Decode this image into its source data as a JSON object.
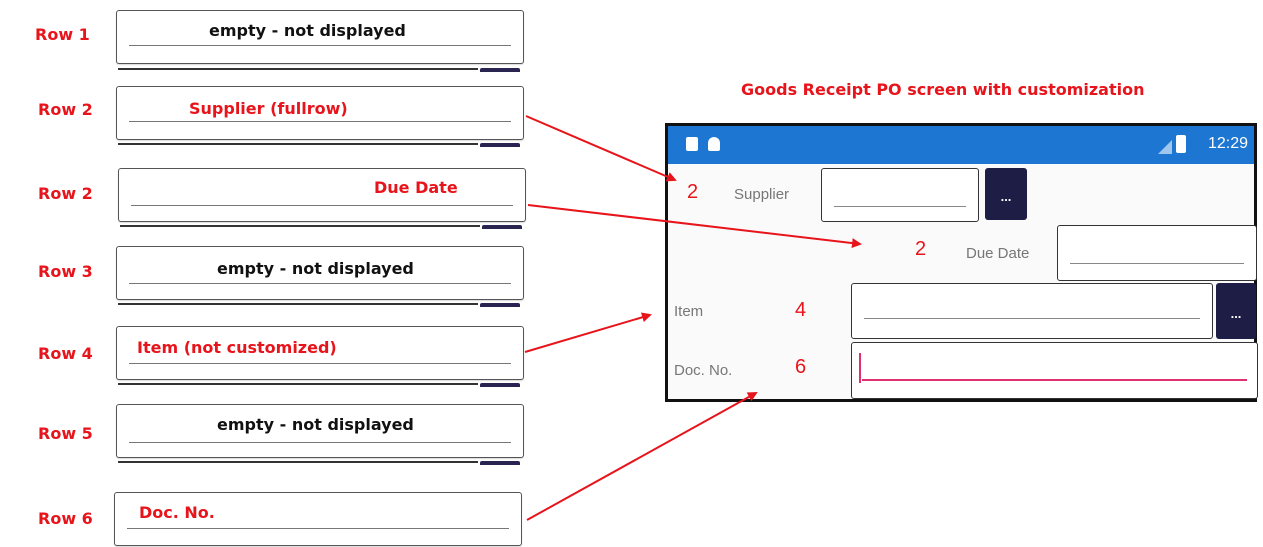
{
  "left_rows": [
    {
      "row": "Row 1",
      "text": "empty - not displayed",
      "color": "black"
    },
    {
      "row": "Row 2",
      "text": "Supplier (fullrow)",
      "color": "red"
    },
    {
      "row": "Row 2",
      "text": "Due Date",
      "color": "red"
    },
    {
      "row": "Row 3",
      "text": "empty - not displayed",
      "color": "black"
    },
    {
      "row": "Row 4",
      "text": "Item (not customized)",
      "color": "red"
    },
    {
      "row": "Row 5",
      "text": "empty - not displayed",
      "color": "black"
    },
    {
      "row": "Row 6",
      "text": "Doc. No.",
      "color": "red"
    }
  ],
  "heading": "Goods Receipt PO screen with customization",
  "phone": {
    "status_time": "12:29",
    "fields": [
      {
        "number": "2",
        "label": "Supplier",
        "button": "..."
      },
      {
        "number": "2",
        "label": "Due Date"
      },
      {
        "number": "4",
        "label": "Item",
        "button": "..."
      },
      {
        "number": "6",
        "label": "Doc. No."
      }
    ]
  },
  "colors": {
    "accent_red": "#e8141b",
    "status_bar": "#1d76d2",
    "button_dark": "#1e1d45",
    "focus_pink": "#e0306f"
  }
}
